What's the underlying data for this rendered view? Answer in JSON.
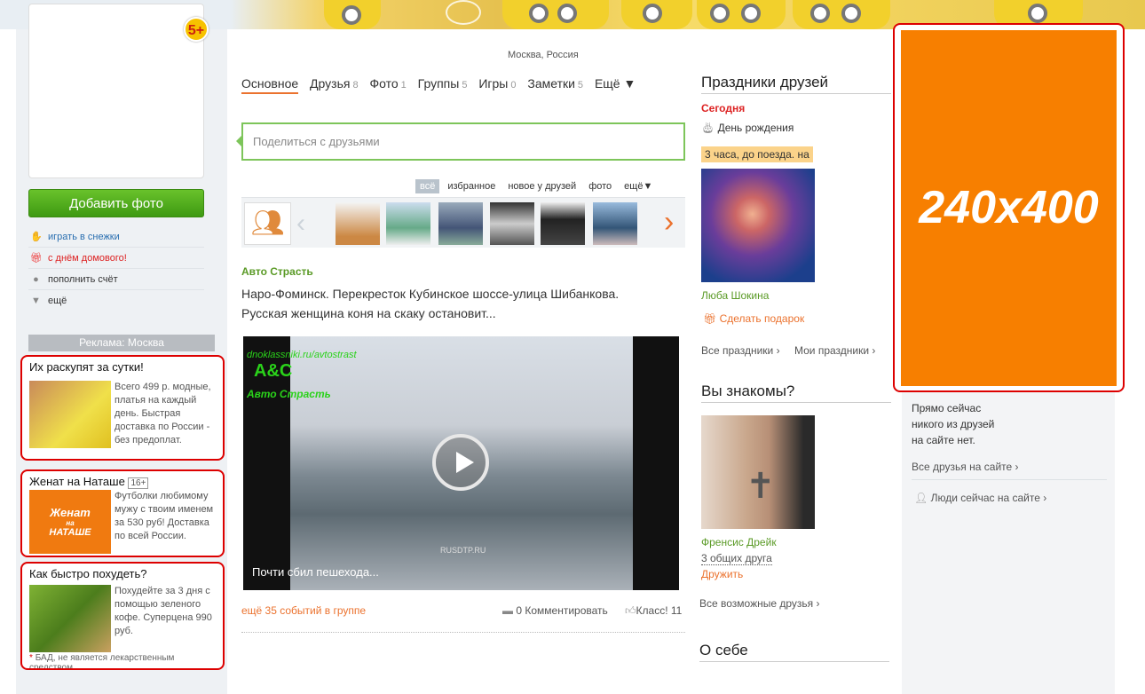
{
  "colors": {
    "accent": "#eb722e",
    "green": "#5a9a26",
    "ad_orange": "#f77f00",
    "ad_border": "#dd0000"
  },
  "banner": {
    "badge": "5+"
  },
  "left": {
    "add_photo": "Добавить фото",
    "links": [
      {
        "label": "играть в снежки",
        "icon": "mitten-icon"
      },
      {
        "label": "с днём домового!",
        "icon": "gift-icon"
      },
      {
        "label": "пополнить счёт",
        "icon": "coin-icon"
      },
      {
        "label": "ещё",
        "icon": "triangle-down-icon"
      }
    ],
    "ads_header": "Реклама: Москва",
    "ads": [
      {
        "title": "Их раскупят за сутки!",
        "text": "Всего 499 р. модные, платья на каждый день. Быстрая доставка по России - без предоплат."
      },
      {
        "title": "Женат на Наташе",
        "age": "16+",
        "text": "Футболки любимому мужу с твоим именем за 530 руб! Доставка по всей России.",
        "shirt_line1": "Женат",
        "shirt_line2": "на",
        "shirt_line3": "НАТАШЕ"
      },
      {
        "title": "Как быстро похудеть?",
        "text": "Похудейте за 3 дня с помощью зеленого кофе. Суперцена 990 руб.",
        "note": "БАД, не является лекарственным средством"
      }
    ]
  },
  "main": {
    "location": "Москва, Россия",
    "tabs": [
      {
        "label": "Основное",
        "count": ""
      },
      {
        "label": "Друзья",
        "count": "8"
      },
      {
        "label": "Фото",
        "count": "1"
      },
      {
        "label": "Группы",
        "count": "5"
      },
      {
        "label": "Игры",
        "count": "0"
      },
      {
        "label": "Заметки",
        "count": "5"
      },
      {
        "label": "Ещё ▼",
        "count": ""
      }
    ],
    "share_placeholder": "Поделиться с друзьями",
    "filters": [
      "всё",
      "избранное",
      "новое у друзей",
      "фото",
      "ещё▼"
    ],
    "post": {
      "group": "Авто Страсть",
      "text": "Наро-Фоминск. Перекресток Кубинское шоссе-улица Шибанкова. Русская женщина коня на скаку остановит...",
      "video_caption": "Почти сбил пешехода...",
      "video_watermark": "dnoklassniki.ru/avtostrast",
      "video_logo": "А&С",
      "video_logo_sub": "Авто Страсть",
      "video_source": "RUSDTP.RU",
      "more_events": "ещё 35 событий в группе",
      "comments": "0 Комментировать",
      "klass": "Класс! 11"
    }
  },
  "holidays": {
    "title": "Праздники друзей",
    "today": "Сегодня",
    "birthday": "День рождения",
    "photo_caption": "3 часа, до поезда. на",
    "friend_name": "Люба Шокина",
    "gift": "Сделать подарок",
    "all_holidays": "Все праздники ›",
    "my_holidays": "Мои праздники ›"
  },
  "acquaint": {
    "title": "Вы знакомы?",
    "name": "Френсис Дрейк",
    "common": "3 общих друга",
    "add": "Дружить",
    "all_friends": "Все возможные друзья ›"
  },
  "about": {
    "title": "О себе"
  },
  "right": {
    "ad_size": "240x400",
    "online_text": [
      "Прямо сейчас",
      "никого из друзей",
      "на сайте нет."
    ],
    "all_online": "Все друзья на сайте ›",
    "people_now": "Люди сейчас на сайте ›"
  }
}
